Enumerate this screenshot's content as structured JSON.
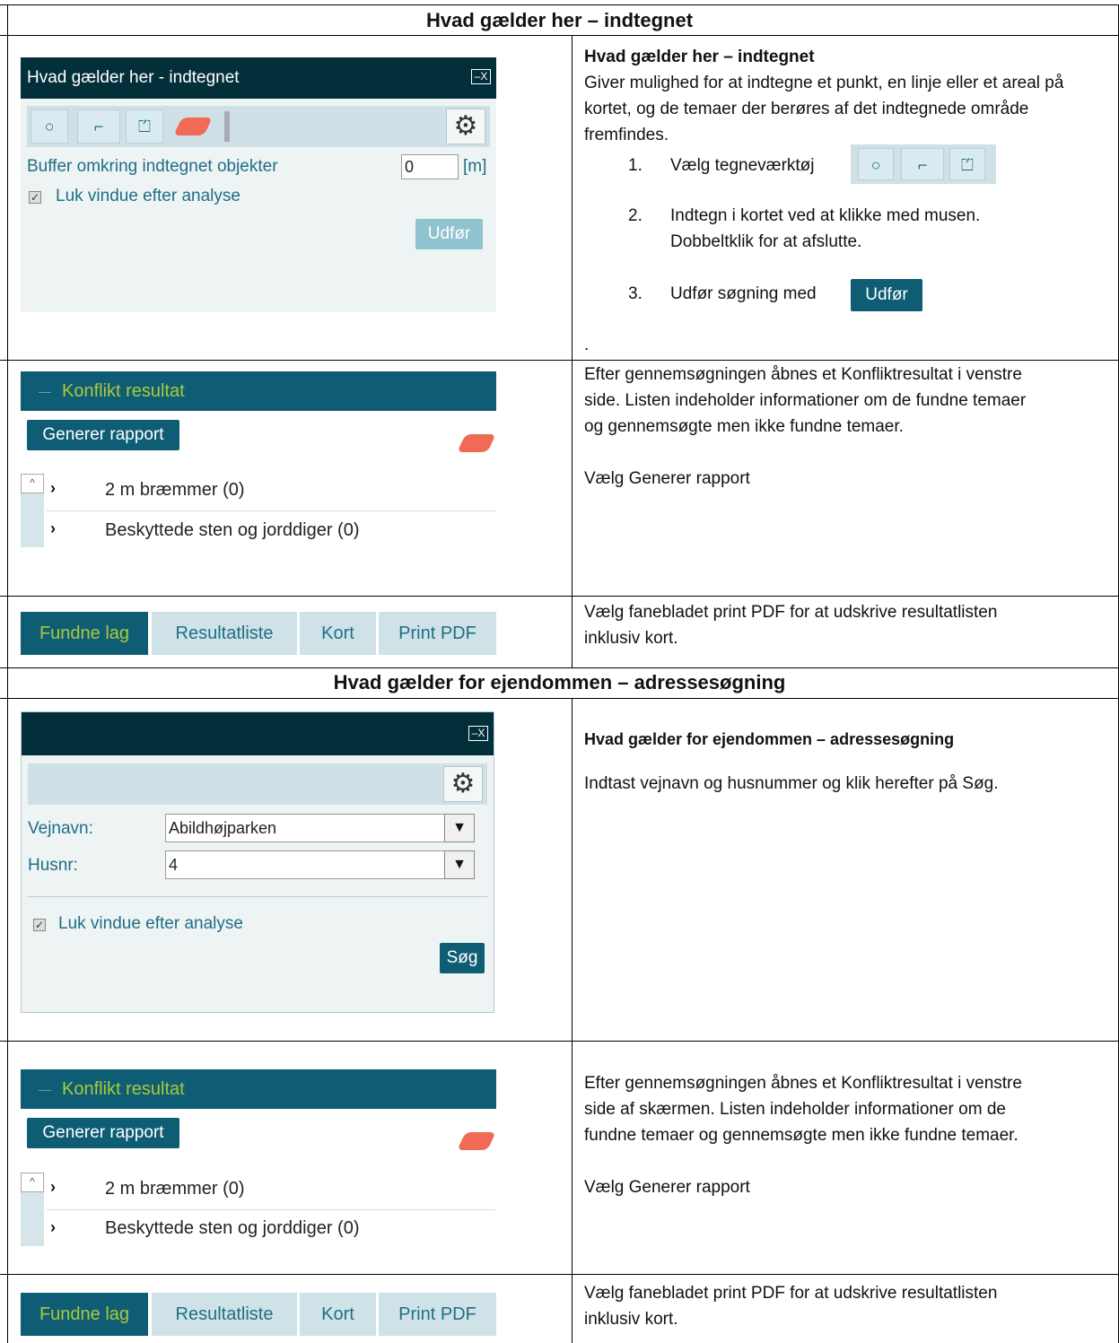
{
  "sections": {
    "s1_title": "Hvad gælder her – indtegnet",
    "s2_title": "Hvad gælder for ejendommen – adressesøgning"
  },
  "draw_window": {
    "title": "Hvad gælder her - indtegnet",
    "win_control": "–X",
    "buffer_label": "Buffer omkring indtegnet objekter",
    "buffer_value": "0",
    "buffer_unit": "[m]",
    "close_checkbox_label": "Luk vindue efter analyse",
    "run_button": "Udfør"
  },
  "desc1": {
    "heading": "Hvad gælder her – indtegnet",
    "intro": "Giver mulighed for at indtegne et punkt, en linje eller et areal på kortet, og de temaer der berøres af det indtegnede område fremfindes.",
    "step1_num": "1.",
    "step1": "Vælg tegneværktøj",
    "step2_num": "2.",
    "step2_a": "Indtegn i kortet ved at klikke med musen.",
    "step2_b": "Dobbeltklik for at afslutte.",
    "step3_num": "3.",
    "step3": "Udfør søgning med",
    "step3_button": "Udfør",
    "dot": "."
  },
  "result1": {
    "header": "Konflikt resultat",
    "generate_button": "Generer rapport",
    "item1": "2 m bræmmer (0)",
    "item2": "Beskyttede sten og jorddiger (0)"
  },
  "desc2": {
    "line1": "Efter gennemsøgningen åbnes et Konfliktresultat i venstre",
    "line2": "side. Listen indeholder informationer om de fundne temaer",
    "line3": "og gennemsøgte men ikke fundne temaer.",
    "action": "Vælg Generer rapport"
  },
  "tabs1": {
    "t1": "Fundne lag",
    "t2": "Resultatliste",
    "t3": "Kort",
    "t4": "Print PDF"
  },
  "desc3": {
    "line1": "Vælg fanebladet print PDF for at udskrive resultatlisten",
    "line2": "inklusiv kort."
  },
  "addr_window": {
    "win_control": "–X",
    "street_label": "Vejnavn:",
    "street_value": "Abildhøjparken",
    "house_label": "Husnr:",
    "house_value": "4",
    "close_checkbox_label": "Luk vindue efter analyse",
    "search_button": "Søg"
  },
  "desc4": {
    "heading": "Hvad gælder for ejendommen – adressesøgning",
    "text": "Indtast vejnavn og husnummer og klik herefter på Søg."
  },
  "result2": {
    "header": "Konflikt resultat",
    "generate_button": "Generer rapport",
    "item1": "2 m bræmmer (0)",
    "item2": "Beskyttede sten og jorddiger (0)"
  },
  "desc5": {
    "line1": "Efter gennemsøgningen åbnes et Konfliktresultat i venstre",
    "line2": "side af skærmen. Listen indeholder informationer om de",
    "line3": "fundne temaer og gennemsøgte men ikke fundne temaer.",
    "action": "Vælg Generer rapport"
  },
  "tabs2": {
    "t1": "Fundne lag",
    "t2": "Resultatliste",
    "t3": "Kort",
    "t4": "Print PDF"
  },
  "desc6": {
    "line1": "Vælg fanebladet print PDF for at udskrive resultatlisten",
    "line2": "inklusiv kort."
  },
  "colors": {
    "title_bar": "#032f3b",
    "accent_teal": "#0f5d75",
    "accent_green_text": "#a9c93a",
    "eraser": "#f06a55"
  }
}
